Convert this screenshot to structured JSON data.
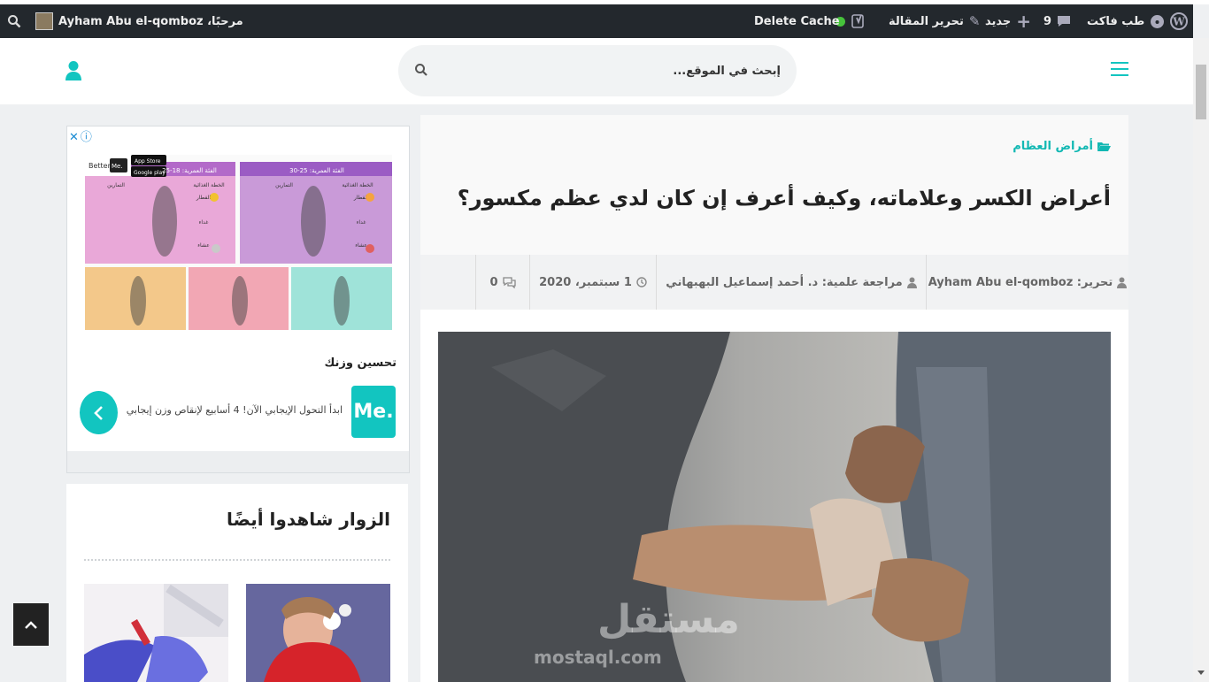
{
  "admin_bar": {
    "site_name": "طب فاكت",
    "comments_count": "9",
    "new_label": "جديد",
    "edit_post_label": "تحرير المقالة",
    "delete_cache_label": "Delete Cache",
    "greeting": "مرحبًا، Ayham Abu el-qomboz"
  },
  "header": {
    "search_placeholder": "إبحث في الموقع..."
  },
  "article": {
    "category": "أمراض العظام",
    "title": "أعراض الكسر وعلاماته، وكيف أعرف إن كان لدي عظم مكسور؟",
    "meta": {
      "author": "تحرير: Ayham Abu el-qomboz",
      "reviewer": "مراجعة علمية: د. أحمد إسماعيل البهبهاني",
      "date": "1 سبتمبر، 2020",
      "comments": "0"
    },
    "watermark": "مستقل",
    "watermark_url": "mostaql.com"
  },
  "ad": {
    "title": "تحسين وزنك",
    "logo_text": "Me.",
    "description": "ابدأ التحول الإيجابي الآن! 4 أسابيع لإنقاص وزن إيجابي",
    "close_glyph": "✕",
    "info_glyph": "ⓘ",
    "poster": {
      "brand": "Better",
      "brand_badge": "Me.",
      "store_app": "App Store",
      "store_google": "Google play",
      "age_a": "الفئة العمرية: 25-30",
      "age_b": "الفئة العمرية: 18-25",
      "section_exercises": "التمارين",
      "section_diet": "الخطة الغذائية",
      "meal_breakfast": "الفطار",
      "meal_lunch": "غداء",
      "meal_dinner": "عشاء"
    }
  },
  "visitors": {
    "heading": "الزوار شاهدوا أيضًا"
  },
  "colors": {
    "accent": "#12c5c0",
    "admin_bar": "#23282d"
  }
}
